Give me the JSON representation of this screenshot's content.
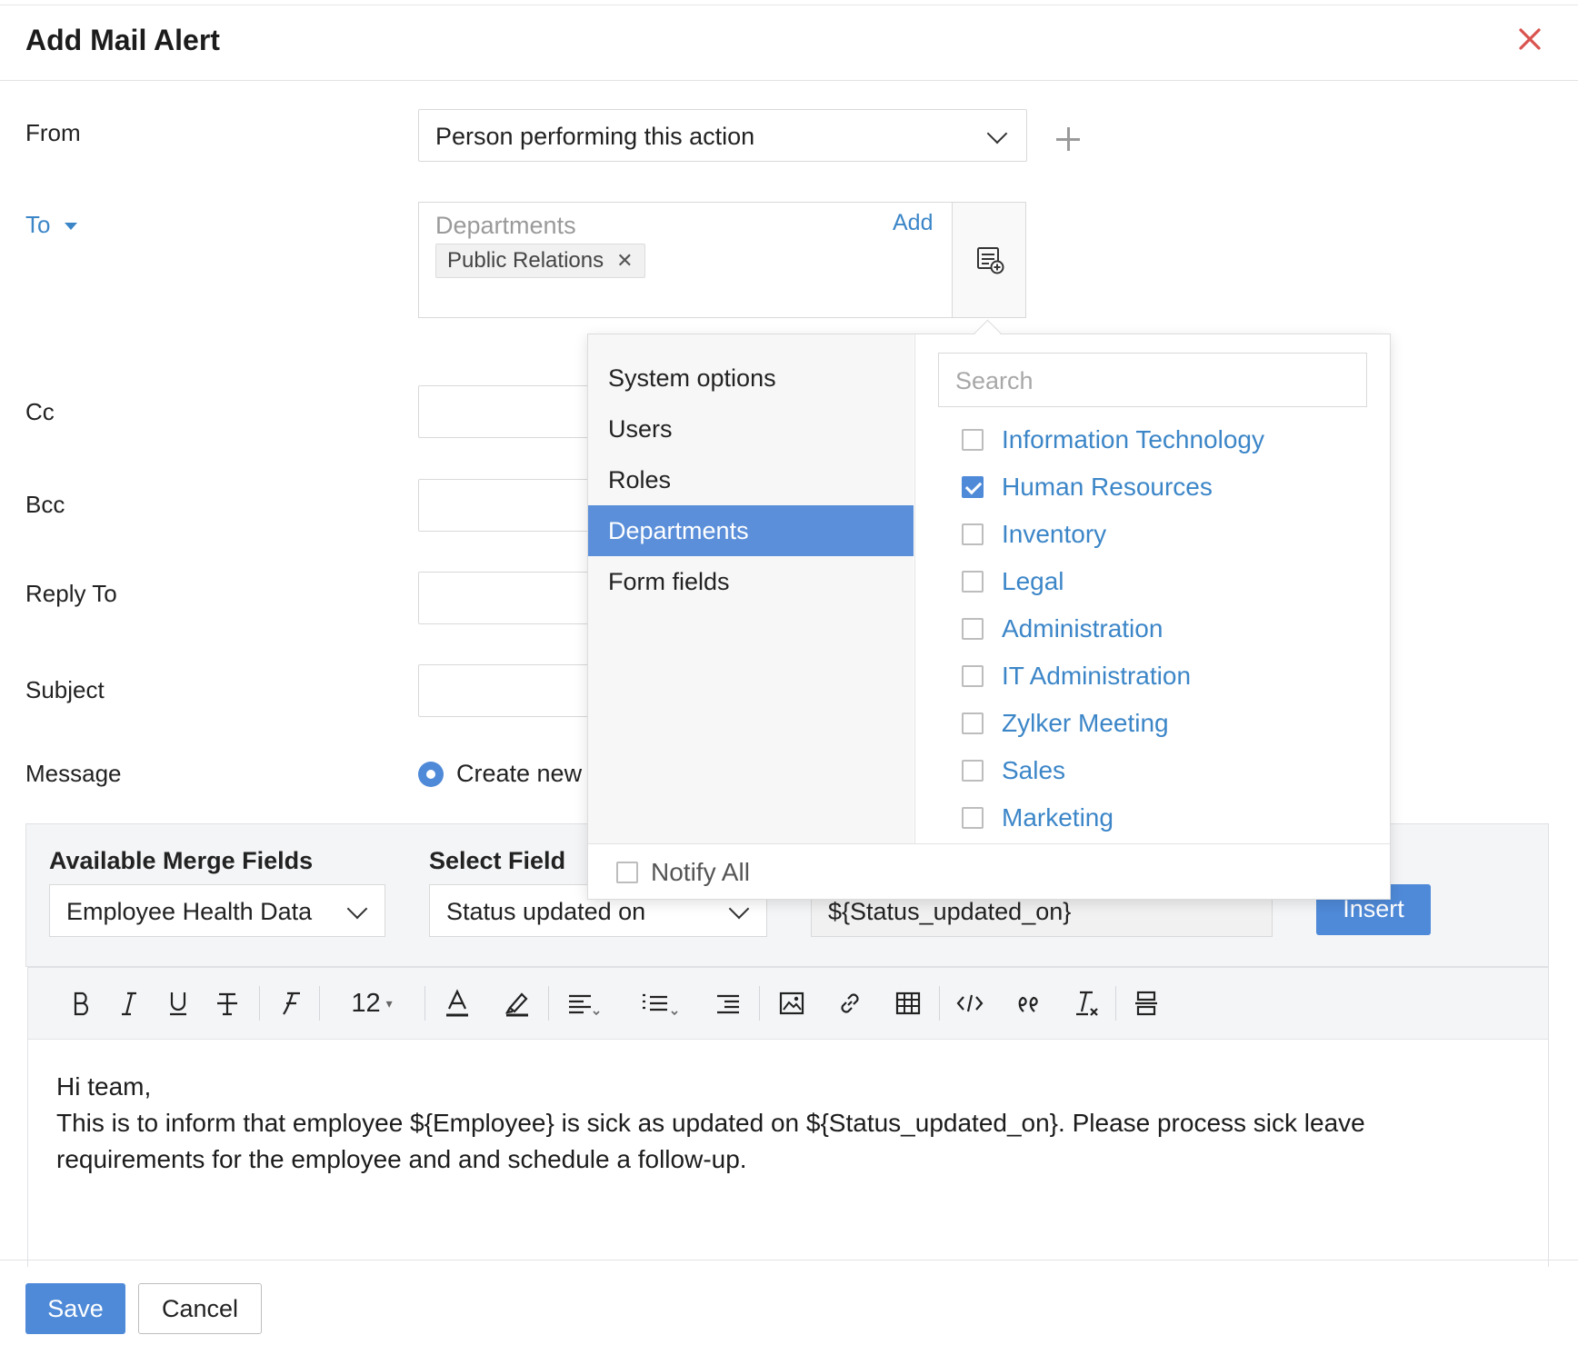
{
  "dialog": {
    "title": "Add Mail Alert"
  },
  "form": {
    "from_label": "From",
    "from_value": "Person performing this action",
    "to_label": "To",
    "to_placeholder": "Departments",
    "to_add": "Add",
    "to_chips": [
      "Public Relations"
    ],
    "cc_label": "Cc",
    "bcc_label": "Bcc",
    "reply_to_label": "Reply To",
    "subject_label": "Subject",
    "message_label": "Message",
    "message_option": "Create new"
  },
  "merge": {
    "available_label": "Available Merge Fields",
    "available_value": "Employee Health Data",
    "select_label": "Select Field",
    "select_value": "Status updated on",
    "placeholder_value": "${Status_updated_on}",
    "insert_label": "Insert"
  },
  "toolbar": {
    "font_size": "12",
    "icons": [
      "bold-icon",
      "italic-icon",
      "underline-icon",
      "strikethrough-icon",
      "font-family-icon",
      "font-size-dropdown",
      "text-color-icon",
      "highlight-icon",
      "align-icon",
      "list-icon",
      "indent-icon",
      "image-icon",
      "link-icon",
      "table-icon",
      "code-icon",
      "quote-icon",
      "clear-format-icon",
      "page-break-icon"
    ]
  },
  "editor": {
    "line1": "Hi team,",
    "line2": "This is to inform that employee ${Employee} is sick as updated on ${Status_updated_on}. Please process sick leave requirements for the employee and and schedule a follow-up."
  },
  "footer": {
    "save_label": "Save",
    "cancel_label": "Cancel"
  },
  "picker": {
    "categories": [
      "System options",
      "Users",
      "Roles",
      "Departments",
      "Form fields"
    ],
    "active_category": "Departments",
    "search_placeholder": "Search",
    "options": [
      {
        "label": "Information Technology",
        "checked": false
      },
      {
        "label": "Human Resources",
        "checked": true
      },
      {
        "label": "Inventory",
        "checked": false
      },
      {
        "label": "Legal",
        "checked": false
      },
      {
        "label": "Administration",
        "checked": false
      },
      {
        "label": "IT Administration",
        "checked": false
      },
      {
        "label": "Zylker Meeting",
        "checked": false
      },
      {
        "label": "Sales",
        "checked": false
      },
      {
        "label": "Marketing",
        "checked": false
      }
    ],
    "notify_all_label": "Notify All",
    "notify_all_checked": false
  },
  "colors": {
    "accent": "#4f8ad8",
    "link": "#3c86c8",
    "close": "#d9534f"
  }
}
